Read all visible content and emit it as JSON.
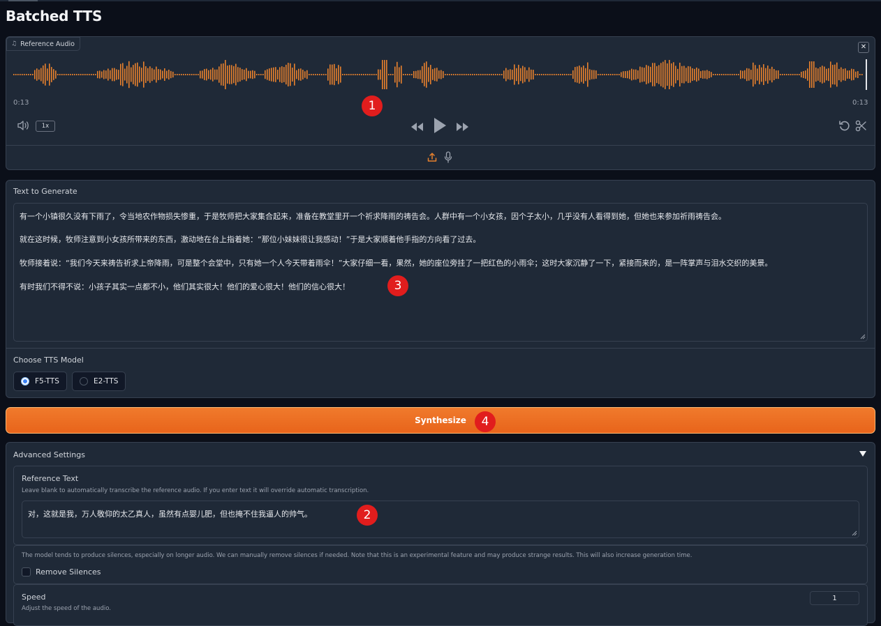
{
  "page": {
    "title": "Batched TTS"
  },
  "audio": {
    "label": "Reference Audio",
    "label_icon": "music-note-icon",
    "time_start": "0:13",
    "time_end": "0:13",
    "playback_rate": "1x",
    "waveform_color": "#e8812d",
    "icons": [
      "speaker-icon",
      "rewind-icon",
      "play-icon",
      "fast-forward-icon",
      "undo-icon",
      "scissors-icon",
      "upload-icon",
      "microphone-icon",
      "close-icon"
    ]
  },
  "generate": {
    "label": "Text to Generate",
    "paragraphs": [
      "有一个小镇很久没有下雨了，令当地农作物损失惨重，于是牧师把大家集合起来，准备在教堂里开一个祈求降雨的祷告会。人群中有一个小女孩，因个子太小，几乎没有人看得到她，但她也来参加祈雨祷告会。",
      "就在这时候，牧师注意到小女孩所带来的东西，激动地在台上指着她：“那位小妹妹很让我感动！”于是大家顺着他手指的方向看了过去。",
      "牧师接着说：“我们今天来祷告祈求上帝降雨，可是整个会堂中，只有她一个人今天带着雨伞！”大家仔细一看，果然，她的座位旁挂了一把红色的小雨伞；这时大家沉静了一下，紧接而来的，是一阵掌声与泪水交织的美景。",
      "有时我们不得不说：小孩子其实一点都不小，他们其实很大！他们的爱心很大！他们的信心很大！"
    ]
  },
  "model": {
    "label": "Choose TTS Model",
    "options": [
      "F5-TTS",
      "E2-TTS"
    ],
    "selected": "F5-TTS"
  },
  "synthesize": {
    "label": "Synthesize"
  },
  "advanced": {
    "label": "Advanced Settings",
    "reference_text": {
      "label": "Reference Text",
      "info": "Leave blank to automatically transcribe the reference audio. If you enter text it will override automatic transcription.",
      "value": "对，这就是我，万人敬仰的太乙真人，虽然有点婴儿肥，但也掩不住我逼人的帅气。"
    },
    "silence_note": "The model tends to produce silences, especially on longer audio. We can manually remove silences if needed. Note that this is an experimental feature and may produce strange results. This will also increase generation time.",
    "remove_silences": {
      "label": "Remove Silences",
      "checked": false
    },
    "speed": {
      "label": "Speed",
      "info": "Adjust the speed of the audio.",
      "value": "1"
    }
  },
  "annotations": {
    "marker_1": "1",
    "marker_2": "2",
    "marker_3": "3",
    "marker_4": "4",
    "color": "#e11d1d"
  },
  "colors": {
    "accent": "#e8641b",
    "background": "#0b0f19",
    "panel": "#1f2937",
    "border": "#374151",
    "selected_radio": "#3b82f6"
  }
}
